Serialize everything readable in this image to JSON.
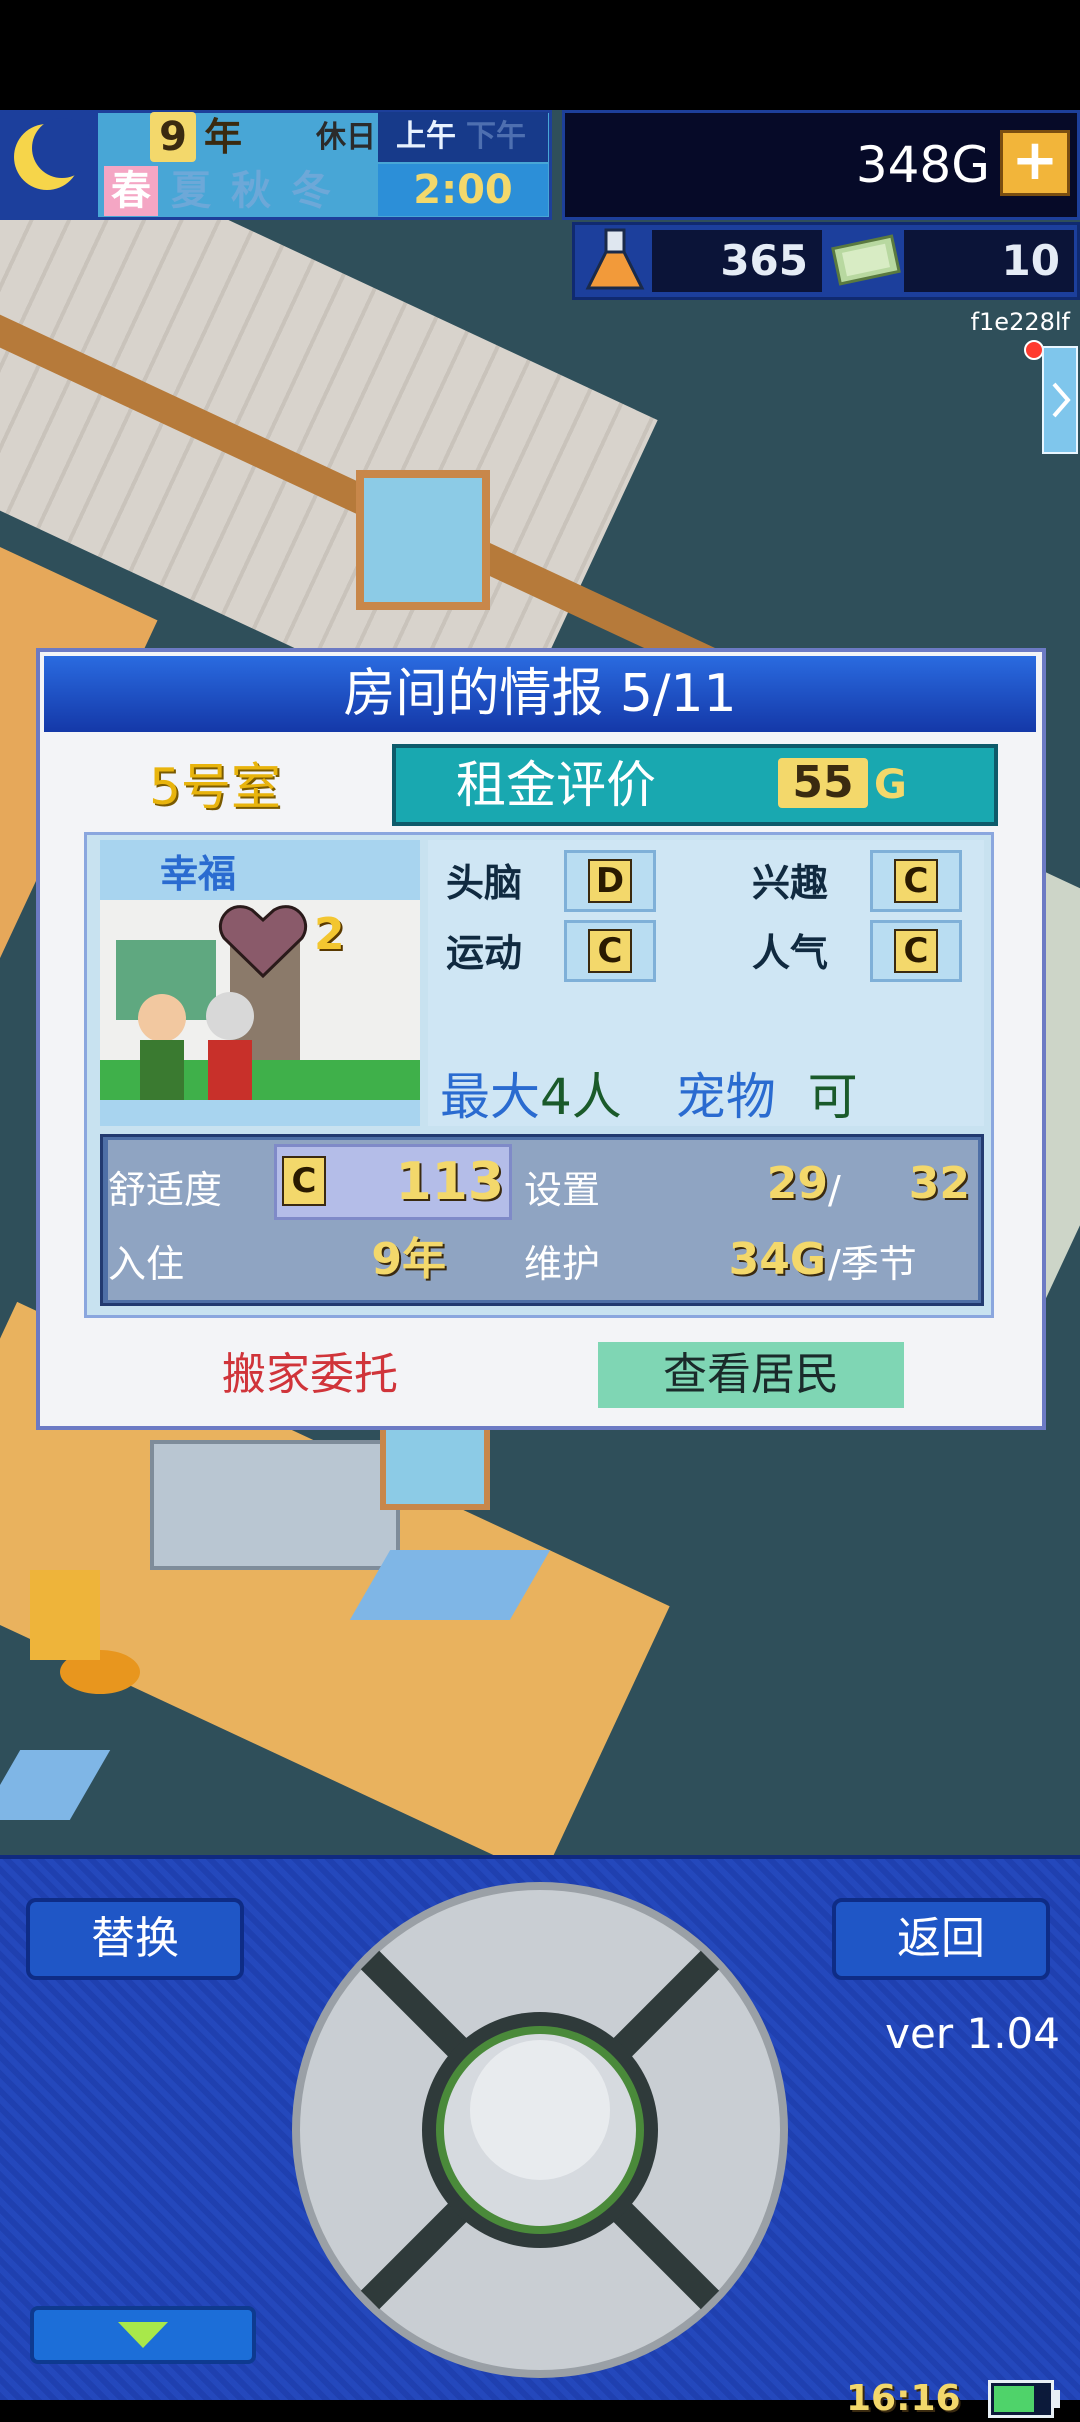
{
  "hud": {
    "year_num": "9",
    "year_unit": "年",
    "holiday": "休日",
    "am": "上午",
    "pm": "下午",
    "seasons": [
      "春",
      "夏",
      "秋",
      "冬"
    ],
    "time": "2:00",
    "money": "348G",
    "plus": "+",
    "research_points": "365",
    "tickets": "10",
    "user_id": "f1e228lf"
  },
  "dialog": {
    "title": "房间的情报 5/11",
    "room_no": "5号室",
    "rent_label": "租金评价",
    "rent_value": "55",
    "rent_unit": "G",
    "happy_text": "幸福",
    "heart_count": "2",
    "stats": [
      {
        "label": "头脑",
        "grade": "D"
      },
      {
        "label": "兴趣",
        "grade": "C"
      },
      {
        "label": "运动",
        "grade": "C"
      },
      {
        "label": "人气",
        "grade": "C"
      }
    ],
    "capacity_label": "最大",
    "capacity_value": "4人",
    "pet_label": "宠物",
    "pet_value": "可",
    "comfort_label": "舒适度",
    "comfort_grade": "C",
    "comfort_value": "113",
    "setting_label": "设置",
    "setting_current": "29",
    "setting_sep": "/",
    "setting_max": "32",
    "residence_label": "入住",
    "residence_value": "9年",
    "maintenance_label": "维护",
    "maintenance_value": "34G",
    "maintenance_unit": "/季节",
    "move_button": "搬家委托",
    "view_button": "查看居民"
  },
  "controls": {
    "swap": "替换",
    "back": "返回",
    "version": "ver 1.04",
    "clock": "16:16"
  },
  "colors": {
    "accent_blue": "#1f56c6",
    "gold": "#f3d86b",
    "teal": "#19a8b0",
    "mint": "#7fd6b4",
    "red_text": "#d0343a"
  }
}
